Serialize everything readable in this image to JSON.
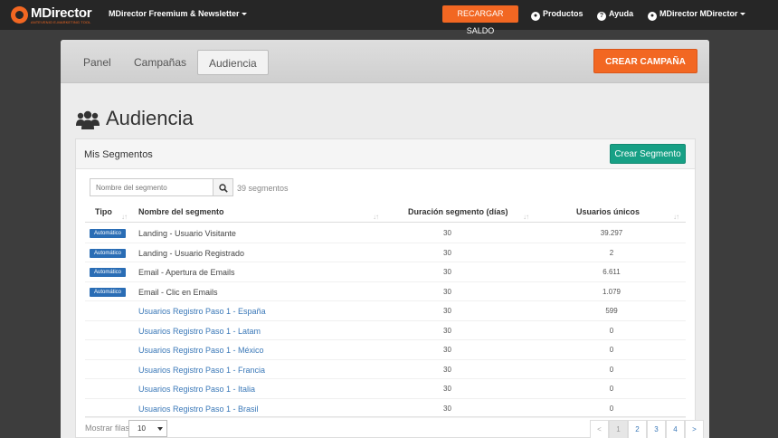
{
  "topbar": {
    "logo_text": "MDirector",
    "logo_tagline": "ANTEVENIO E-MARKETING TOOL",
    "account_menu": "MDirector Freemium & Newsletter",
    "recharge_label": "RECARGAR SALDO",
    "products_label": "Productos",
    "help_label": "Ayuda",
    "user_label": "MDirector MDirector"
  },
  "tabs": [
    {
      "label": "Panel"
    },
    {
      "label": "Campañas"
    },
    {
      "label": "Audiencia"
    }
  ],
  "create_campaign_label": "CREAR CAMPAÑA",
  "page_title": "Audiencia",
  "segments": {
    "title": "Mis Segmentos",
    "create_label": "Crear Segmento",
    "search_placeholder": "Nombre del segmento",
    "count_text": "39 segmentos",
    "columns": {
      "type": "Tipo",
      "name": "Nombre del segmento",
      "duration": "Duración segmento (días)",
      "users": "Usuarios únicos"
    },
    "auto_badge": "Automático",
    "rows": [
      {
        "name": "Landing - Usuario Visitante",
        "duration": "30",
        "users": "39.297"
      },
      {
        "name": "Landing - Usuario Registrado",
        "duration": "30",
        "users": "2"
      },
      {
        "name": "Email - Apertura de Emails",
        "duration": "30",
        "users": "6.611"
      },
      {
        "name": "Email - Clic en Emails",
        "duration": "30",
        "users": "1.079"
      },
      {
        "name": "Usuarios Registro Paso 1 - España",
        "duration": "30",
        "users": "599"
      },
      {
        "name": "Usuarios Registro Paso 1 - Latam",
        "duration": "30",
        "users": "0"
      },
      {
        "name": "Usuarios Registro Paso 1 - México",
        "duration": "30",
        "users": "0"
      },
      {
        "name": "Usuarios Registro Paso 1 - Francia",
        "duration": "30",
        "users": "0"
      },
      {
        "name": "Usuarios Registro Paso 1 - Italia",
        "duration": "30",
        "users": "0"
      },
      {
        "name": "Usuarios Registro Paso 1 - Brasil",
        "duration": "30",
        "users": "0"
      }
    ],
    "rows_label": "Mostrar filas",
    "rows_value": "10",
    "pagination": [
      "<",
      "1",
      "2",
      "3",
      "4",
      ">"
    ]
  }
}
